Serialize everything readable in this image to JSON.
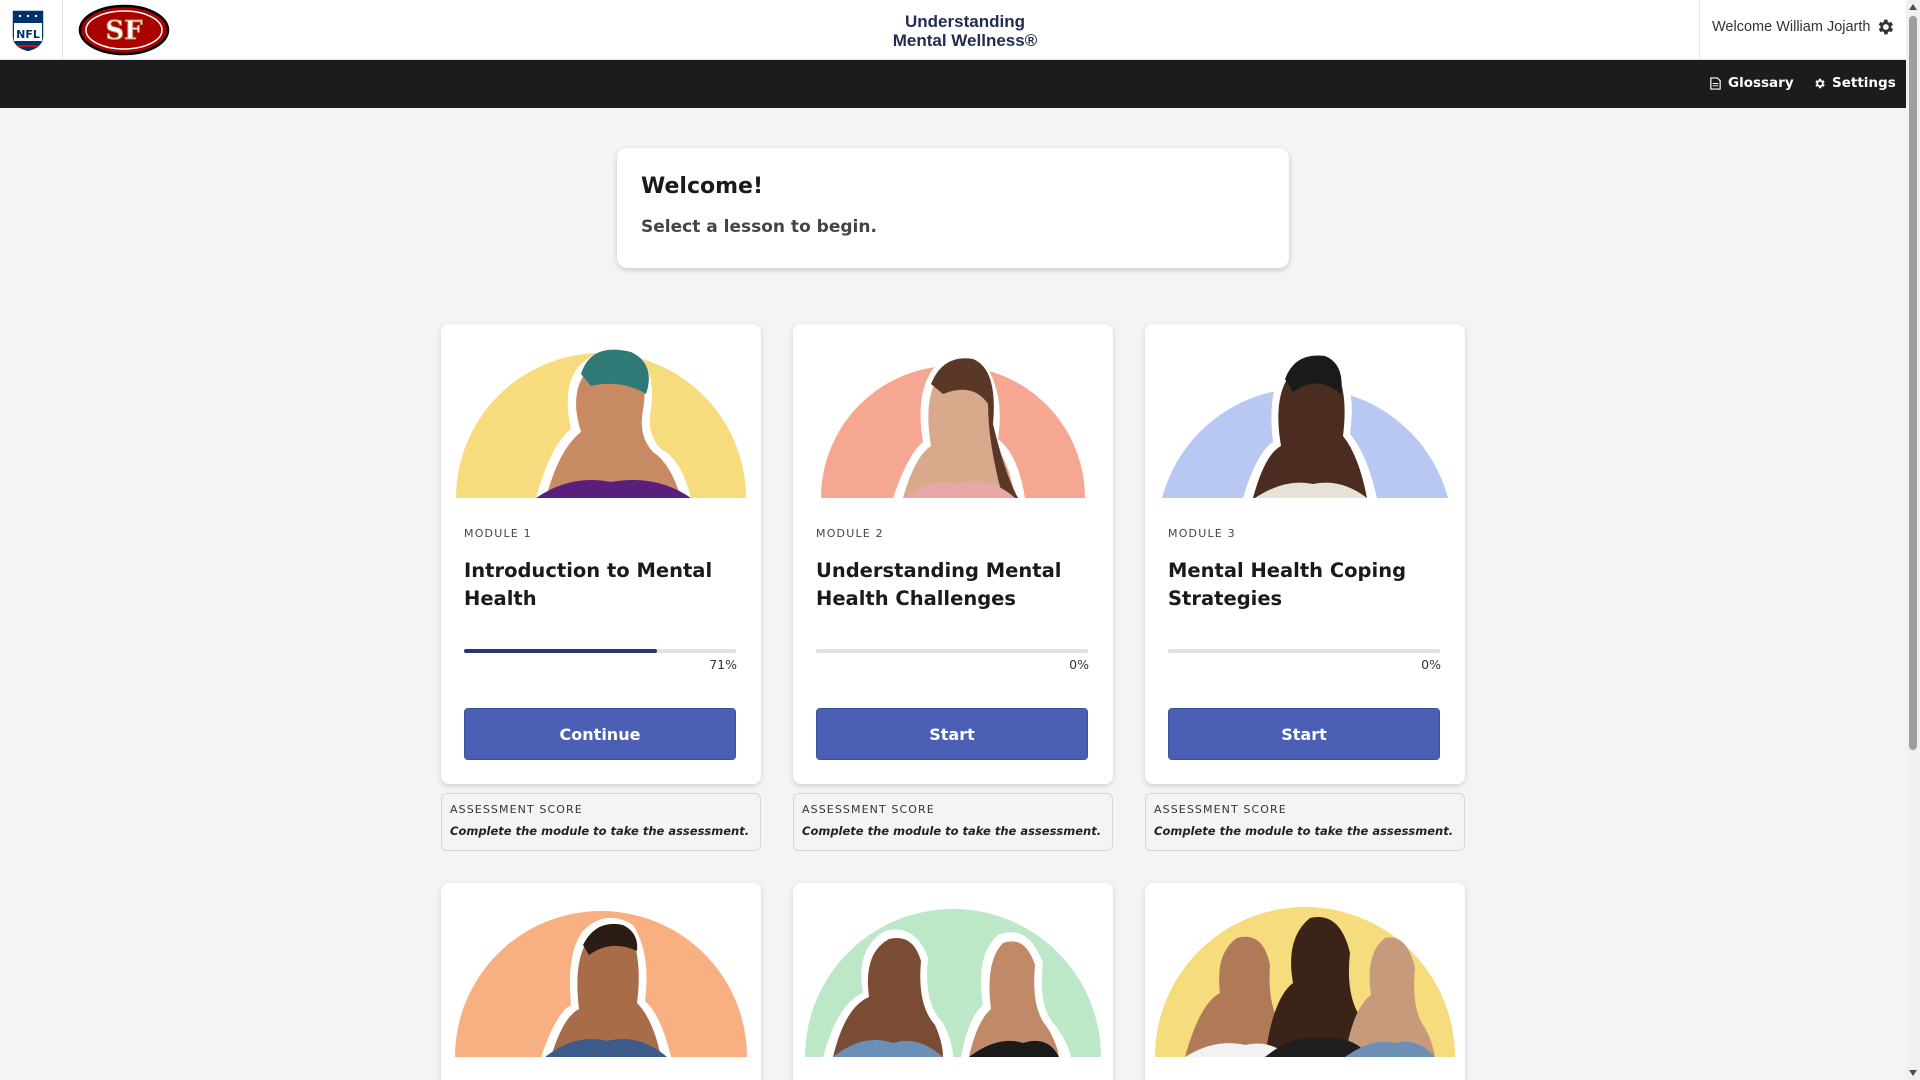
{
  "header": {
    "brand_line1": "Understanding",
    "brand_line2": "Mental Wellness®",
    "welcome_user": "Welcome William Jojarth",
    "logos": [
      "nfl-logo",
      "49ers-logo"
    ]
  },
  "nav": {
    "glossary": "Glossary",
    "settings": "Settings"
  },
  "welcome": {
    "title": "Welcome!",
    "subtitle": "Select a lesson to begin."
  },
  "modules": [
    {
      "label": "MODULE 1",
      "title": "Introduction to Mental Health",
      "progress": 71,
      "progress_text": "71%",
      "button": "Continue",
      "assessment_label": "ASSESSMENT SCORE",
      "assessment_note": "Complete the module to take the assessment.",
      "bg_color": "#f7dc7e"
    },
    {
      "label": "MODULE 2",
      "title": "Understanding Mental Health Challenges",
      "progress": 0,
      "progress_text": "0%",
      "button": "Start",
      "assessment_label": "ASSESSMENT SCORE",
      "assessment_note": "Complete the module to take the assessment.",
      "bg_color": "#f6a792"
    },
    {
      "label": "MODULE 3",
      "title": "Mental Health Coping Strategies",
      "progress": 0,
      "progress_text": "0%",
      "button": "Start",
      "assessment_label": "ASSESSMENT SCORE",
      "assessment_note": "Complete the module to take the assessment.",
      "bg_color": "#b9c8f2"
    }
  ],
  "colors": {
    "primary_button": "#4b5fb4",
    "progress_fill": "#2c3272",
    "nav_bg": "#1c1c1c",
    "brand_text": "#1e2d50"
  }
}
